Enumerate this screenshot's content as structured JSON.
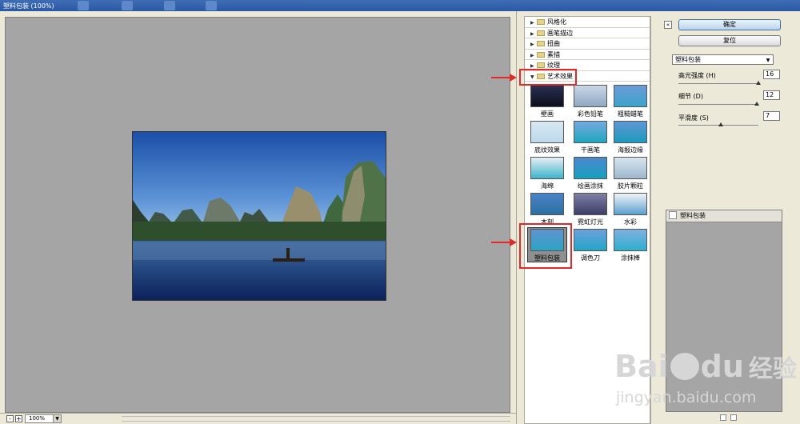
{
  "window": {
    "title": "塑料包装 (100%)"
  },
  "status": {
    "zoom": "100%",
    "zoom_out": "-",
    "zoom_in": "+"
  },
  "gallery": {
    "categories": [
      {
        "label": "风格化",
        "expanded": false
      },
      {
        "label": "画笔描边",
        "expanded": false
      },
      {
        "label": "扭曲",
        "expanded": false
      },
      {
        "label": "素描",
        "expanded": false
      },
      {
        "label": "纹理",
        "expanded": false
      },
      {
        "label": "艺术效果",
        "expanded": true
      }
    ],
    "thumbnails": [
      "壁画",
      "彩色铅笔",
      "粗糙蜡笔",
      "底纹效果",
      "干画笔",
      "海报边缘",
      "海绵",
      "绘画涂抹",
      "胶片颗粒",
      "木刻",
      "霓虹灯光",
      "水彩",
      "塑料包装",
      "调色刀",
      "涂抹棒"
    ],
    "selected": "塑料包装"
  },
  "panel": {
    "ok_label": "确定",
    "reset_label": "复位",
    "collapse_icon": "«",
    "filter_select": "塑料包装",
    "params": [
      {
        "label": "高光强度 (H)",
        "value": "16",
        "level": 0.8
      },
      {
        "label": "细节 (D)",
        "value": "12",
        "level": 0.73
      },
      {
        "label": "平滑度 (S)",
        "value": "7",
        "level": 0.47
      }
    ]
  },
  "layers": {
    "items": [
      {
        "label": "塑料包装"
      }
    ]
  },
  "watermark": {
    "brand": "Bai",
    "brand2": "du",
    "brand_cn": "经验",
    "url": "jingyan.baidu.com"
  },
  "colors": {
    "annotation": "#e02a2a",
    "ok_button": "#bcd4ec",
    "preview_bg": "#a5a5a5"
  }
}
